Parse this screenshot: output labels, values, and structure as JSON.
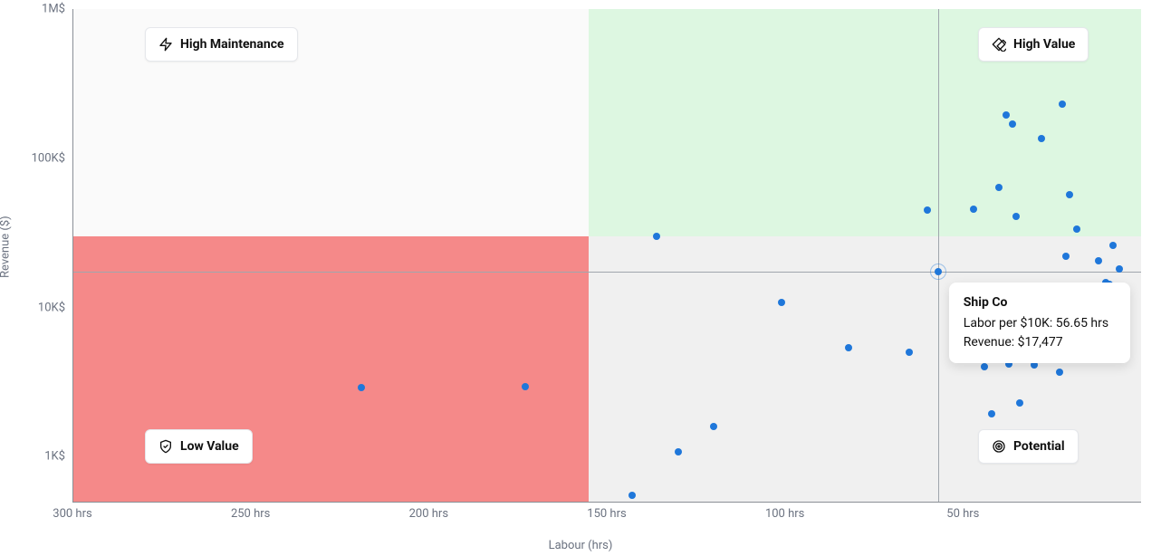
{
  "chart_data": {
    "type": "scatter",
    "xlabel": "Labour (hrs)",
    "ylabel": "Revenue ($)",
    "x_reversed": true,
    "x_ticks": [
      300,
      250,
      200,
      150,
      100,
      50
    ],
    "x_tick_suffix": " hrs",
    "y_scale": "log",
    "y_ticks": [
      1000,
      10000,
      100000,
      1000000
    ],
    "y_tick_labels": [
      "1K$",
      "10K$",
      "100K$",
      "1M$"
    ],
    "x_range": [
      300,
      0
    ],
    "y_range": [
      500,
      1000000
    ],
    "quadrants": {
      "x_split": 155,
      "y_split": 30000,
      "top_left": {
        "label": "High Maintenance",
        "icon": "zap",
        "fill": "#FAFAFA"
      },
      "top_right": {
        "label": "High Value",
        "icon": "diamond",
        "fill": "#DDF7E1"
      },
      "bottom_left": {
        "label": "Low Value",
        "icon": "shield-check",
        "fill": "#F58989"
      },
      "bottom_right": {
        "label": "Potential",
        "icon": "target",
        "fill": "#F0F0F0"
      }
    },
    "points": [
      {
        "x": 219,
        "y": 2900
      },
      {
        "x": 173,
        "y": 2950
      },
      {
        "x": 143,
        "y": 550
      },
      {
        "x": 136,
        "y": 30000
      },
      {
        "x": 130,
        "y": 1080
      },
      {
        "x": 120,
        "y": 1600
      },
      {
        "x": 101,
        "y": 10800
      },
      {
        "x": 82,
        "y": 5400
      },
      {
        "x": 65,
        "y": 5000
      },
      {
        "x": 60,
        "y": 45000
      },
      {
        "x": 57,
        "y": 17477,
        "name": "Ship Co",
        "labor_per_10k_hrs": 56.65,
        "highlight": true
      },
      {
        "x": 47,
        "y": 45500
      },
      {
        "x": 44,
        "y": 4000
      },
      {
        "x": 42,
        "y": 1950
      },
      {
        "x": 40,
        "y": 64000
      },
      {
        "x": 38,
        "y": 195000
      },
      {
        "x": 37,
        "y": 4200
      },
      {
        "x": 36,
        "y": 170000
      },
      {
        "x": 35,
        "y": 40500
      },
      {
        "x": 34,
        "y": 2300
      },
      {
        "x": 30,
        "y": 4100
      },
      {
        "x": 28,
        "y": 135000
      },
      {
        "x": 23,
        "y": 3700
      },
      {
        "x": 22,
        "y": 230000
      },
      {
        "x": 21,
        "y": 22000
      },
      {
        "x": 20,
        "y": 57000
      },
      {
        "x": 18,
        "y": 33500
      },
      {
        "x": 12,
        "y": 20500
      },
      {
        "x": 10,
        "y": 14700
      },
      {
        "x": 9,
        "y": 14200
      },
      {
        "x": 8,
        "y": 26000
      },
      {
        "x": 7,
        "y": 10200
      },
      {
        "x": 6,
        "y": 18200
      }
    ],
    "tooltip": {
      "title": "Ship Co",
      "line1": "Labor per $10K: 56.65 hrs",
      "line2": "Revenue: $17,477"
    }
  }
}
